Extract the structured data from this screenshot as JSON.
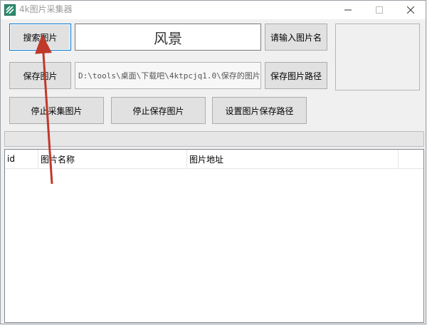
{
  "window": {
    "title": "4k图片采集器",
    "controls": [
      "minimize-icon",
      "maximize-icon",
      "close-icon"
    ]
  },
  "toolbar": {
    "search_label": "搜索图片",
    "keyword_value": "风景",
    "keyword_hint_label": "请输入图片名",
    "save_label": "保存图片",
    "save_path_value": "D:\\tools\\桌面\\下载吧\\4ktpcjq1.0\\保存的图片",
    "save_path_button_label": "保存图片路径",
    "stop_collect_label": "停止采集图片",
    "stop_save_label": "停止保存图片",
    "set_path_label": "设置图片保存路径"
  },
  "progress": {
    "value": 0
  },
  "table": {
    "columns": [
      "id",
      "图片名称",
      "图片地址"
    ],
    "rows": []
  },
  "colors": {
    "annotation_arrow": "#c0392b",
    "focus_border": "#0078d7"
  }
}
